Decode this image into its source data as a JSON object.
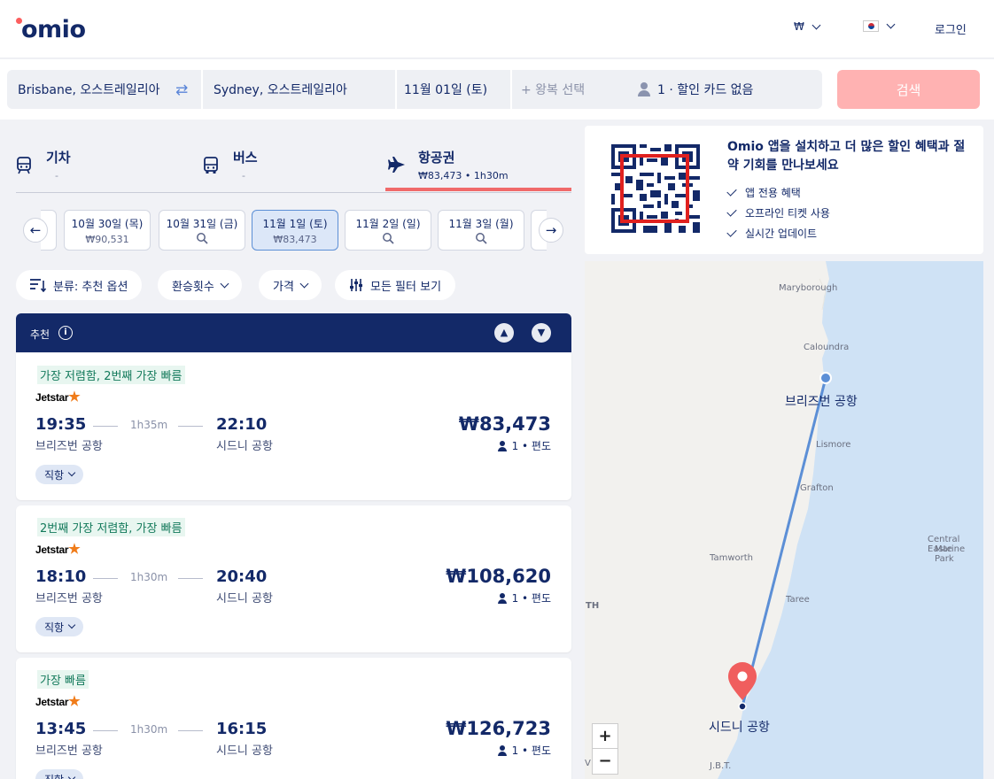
{
  "header": {
    "logo": "omio",
    "currency": "₩",
    "login": "로그인"
  },
  "search": {
    "origin": "Brisbane, 오스트레일리아",
    "destination": "Sydney, 오스트레일리아",
    "depart_date": "11월 01일 (토)",
    "return_placeholder": "+ 왕복 선택",
    "passengers": "1 · 할인 카드 없음",
    "button": "검색"
  },
  "tabs": [
    {
      "title": "기차",
      "sub": "-"
    },
    {
      "title": "버스",
      "sub": "-"
    },
    {
      "title": "항공권",
      "sub": "₩83,473 • 1h30m"
    }
  ],
  "dates": [
    {
      "label": "10월 30일 (목)",
      "price": "₩90,531"
    },
    {
      "label": "10월 31일 (금)",
      "price": ""
    },
    {
      "label": "11월 1일 (토)",
      "price": "₩83,473"
    },
    {
      "label": "11월 2일 (일)",
      "price": ""
    },
    {
      "label": "11월 3일 (월)",
      "price": ""
    }
  ],
  "filters": {
    "sort": "분류: 추천 옵션",
    "transfers": "환승횟수",
    "price": "가격",
    "all_filters": "모든 필터 보기"
  },
  "recommended": {
    "title": "추천"
  },
  "results": [
    {
      "tag": "가장 저렴함, 2번째 가장 빠름",
      "carrier": "Jetstar",
      "dep_time": "19:35",
      "arr_time": "22:10",
      "duration": "1h35m",
      "dep_station": "브리즈번 공항",
      "arr_station": "시드니 공항",
      "price": "₩83,473",
      "pax": "1 • 편도",
      "stops": "직항"
    },
    {
      "tag": "2번째 가장 저렴함, 가장 빠름",
      "carrier": "Jetstar",
      "dep_time": "18:10",
      "arr_time": "20:40",
      "duration": "1h30m",
      "dep_station": "브리즈번 공항",
      "arr_station": "시드니 공항",
      "price": "₩108,620",
      "pax": "1 • 편도",
      "stops": "직항"
    },
    {
      "tag": "가장 빠름",
      "carrier": "Jetstar",
      "dep_time": "13:45",
      "arr_time": "16:15",
      "duration": "1h30m",
      "dep_station": "브리즈번 공항",
      "arr_station": "시드니 공항",
      "price": "₩126,723",
      "pax": "1 • 편도",
      "stops": "직항"
    }
  ],
  "promo": {
    "title": "Omio 앱을 설치하고 더 많은 할인 혜택과 절약 기회를 만나보세요",
    "items": [
      "앱 전용 혜택",
      "오프라인 티켓 사용",
      "실시간 업데이트"
    ]
  },
  "map": {
    "labels": {
      "maryborough": "Maryborough",
      "caloundra": "Caloundra",
      "origin_airport": "브리즈번 공항",
      "lismore": "Lismore",
      "grafton": "Grafton",
      "central": "Central Easte",
      "marine": "Marine Park",
      "tamworth": "Tamworth",
      "th": "TH",
      "taree": "Taree",
      "dest_airport": "시드니 공항",
      "jbt": "J.B.T.",
      "v": "V"
    },
    "zoom_in": "+",
    "zoom_out": "−"
  },
  "colors": {
    "brand": "#132968",
    "accent": "#fc5e5e",
    "search_button": "#ffb2b2",
    "tag_green": "#137a5b"
  }
}
